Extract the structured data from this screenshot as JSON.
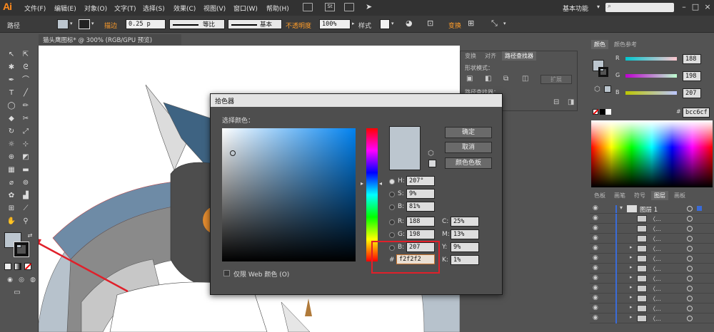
{
  "app": {
    "logo": "Ai",
    "search_icon": "search-icon"
  },
  "menu": [
    "文件(F)",
    "编辑(E)",
    "对象(O)",
    "文字(T)",
    "选择(S)",
    "效果(C)",
    "视图(V)",
    "窗口(W)",
    "帮助(H)"
  ],
  "menu_extra": {
    "st": "St",
    "workspace": "基本功能"
  },
  "control": {
    "object_label": "路径",
    "stroke_label": "描边",
    "stroke_value": "0.25 p",
    "stroke_profile": "等比",
    "brush": "基本",
    "opacity_label": "不透明度",
    "opacity_value": "100%",
    "style_label": "样式",
    "transform": "变换"
  },
  "document_tab": "猫头鹰图标* @ 300% (RGB/GPU 预览)",
  "pathfinder": {
    "tabs": [
      "变换",
      "对齐",
      "路径查找器"
    ],
    "shape_modes": "形状模式：",
    "expand": "扩展",
    "pathfinders": "路径查找器："
  },
  "color_panel": {
    "tabs": [
      "颜色",
      "颜色参考"
    ],
    "r": "188",
    "g": "198",
    "b": "207",
    "hex": "bcc6cf",
    "accent": "#bcc6cf"
  },
  "layers_panel": {
    "tabs": [
      "色板",
      "画笔",
      "符号",
      "图层",
      "画板"
    ],
    "layer_name": "图层 1",
    "rows": [
      "〈...",
      "〈...",
      "〈...",
      "〈...",
      "〈...",
      "〈...",
      "〈...",
      "〈...",
      "〈...",
      "〈...",
      "〈..."
    ]
  },
  "dialog": {
    "title": "拾色器",
    "select_label": "选择颜色：",
    "ok": "确定",
    "cancel": "取消",
    "swatches": "颜色色板",
    "H": "207°",
    "S": "9%",
    "B": "81%",
    "R": "188",
    "G": "198",
    "Bv": "207",
    "C": "25%",
    "M": "13%",
    "Y": "9%",
    "K": "1%",
    "hex": "f2f2f2",
    "web_only": "仅限 Web 颜色 (O)",
    "labels": {
      "H": "H:",
      "S": "S:",
      "B": "B:",
      "R": "R:",
      "G": "G:",
      "Bb": "B:",
      "C": "C:",
      "M": "M:",
      "Y": "Y:",
      "K": "K:",
      "hash": "#"
    },
    "new_color": "#bcc6cf"
  }
}
